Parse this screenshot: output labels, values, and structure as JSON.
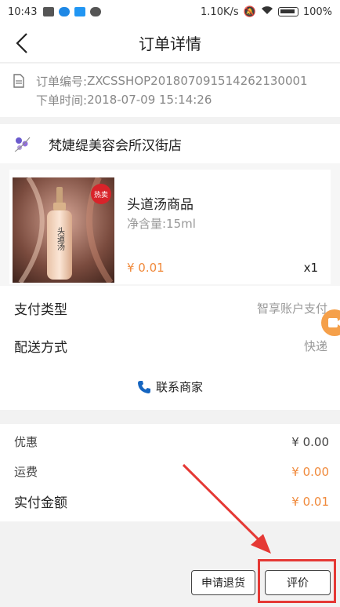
{
  "status_bar": {
    "time": "10:43",
    "network_speed": "1.10K/s",
    "battery": "100%"
  },
  "nav": {
    "title": "订单详情"
  },
  "order": {
    "number_label": "订单编号:",
    "number": "ZXCSSHOP20180709151426213000​1",
    "time_label": "下单时间:",
    "time": "2018-07-09 15:14:26"
  },
  "shop": {
    "name": "梵婕缇美容会所汉街店"
  },
  "product": {
    "badge": "热卖",
    "name": "头道汤商品",
    "spec": "净含量:15ml",
    "price": "¥ 0.01",
    "qty": "x1",
    "bottle_text": "头道汤"
  },
  "details": {
    "pay_label": "支付类型",
    "pay_value": "智享账户支付",
    "delivery_label": "配送方式",
    "delivery_value": "快递",
    "contact": "联系商家"
  },
  "summary": {
    "discount_label": "优惠",
    "discount_value": "¥ 0.00",
    "shipping_label": "运费",
    "shipping_value": "¥ 0.00",
    "total_label": "实付金额",
    "total_value": "¥ 0.01"
  },
  "actions": {
    "refund": "申请退货",
    "review": "评价"
  },
  "colors": {
    "accent": "#f08a3c",
    "highlight": "#e53935"
  }
}
